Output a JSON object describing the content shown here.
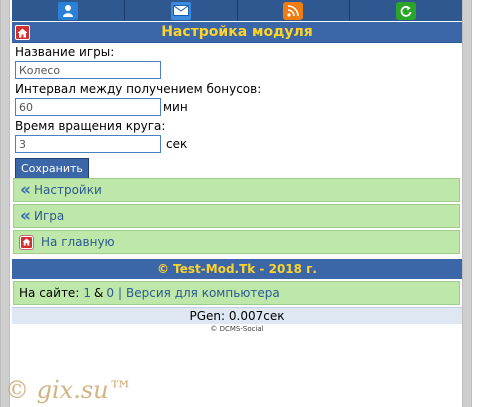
{
  "top_menu": {
    "items": [
      {
        "icon": "user-icon"
      },
      {
        "icon": "mail-icon"
      },
      {
        "icon": "rss-icon"
      },
      {
        "icon": "refresh-icon"
      }
    ]
  },
  "header": {
    "title": "Настройка модуля"
  },
  "form": {
    "game_name_label": "Название игры:",
    "game_name_value": "Колесо",
    "bonus_interval_label": "Интервал между получением бонусов:",
    "bonus_interval_value": "60",
    "bonus_interval_unit": "мин",
    "spin_time_label": "Время вращения круга:",
    "spin_time_value": "3",
    "spin_time_unit": "сек",
    "save_label": "Сохранить"
  },
  "nav": {
    "settings_arrow": "«",
    "settings_label": "Настройки",
    "game_arrow": "«",
    "game_label": "Игра",
    "home_label": "На главную"
  },
  "footer": {
    "copyright": "© Test-Mod.Tk - 2018 г.",
    "online_prefix": "На сайте:",
    "online_users": "1",
    "online_amp": "&",
    "online_guests": "0",
    "online_sep": "|",
    "desktop_link": "Версия для компьютера",
    "pgen": "PGen: 0.007сек",
    "engine": "© DCMS-Social"
  },
  "watermark": "© gix.su™",
  "colors": {
    "header_bg": "#3b66a8",
    "title_text": "#ffd42a",
    "nav_bg": "#bee8a9",
    "link": "#2f5891"
  }
}
